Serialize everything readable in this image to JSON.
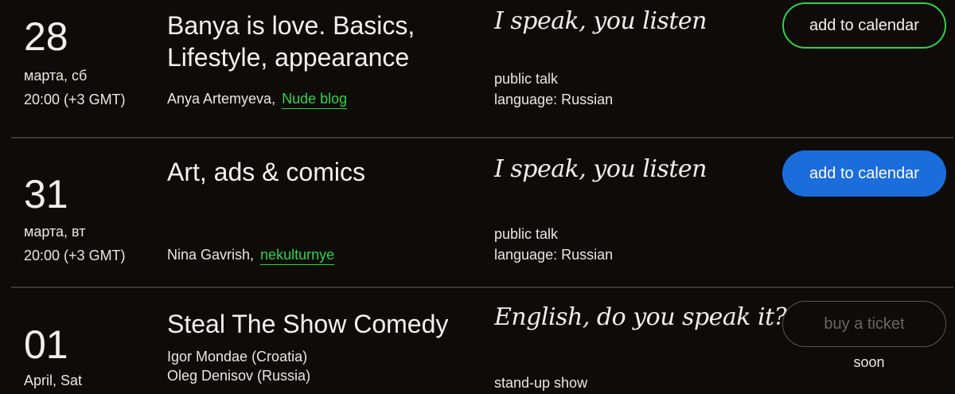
{
  "events": [
    {
      "day": "28",
      "weekday": "марта, сб",
      "time": "20:00 (+3 GMT)",
      "title": "Banya is love. Basics, Lifestyle, appearance",
      "speaker": "Anya Artemyeva,",
      "speaker_link": "Nude blog",
      "series": "I speak, you listen",
      "format": "public talk",
      "language": "language: Russian",
      "button": "add to calendar"
    },
    {
      "day": "31",
      "weekday": "марта, вт",
      "time": "20:00 (+3 GMT)",
      "title": "Art, ads & comics",
      "speaker": "Nina Gavrish,",
      "speaker_link": "nekulturnye",
      "series": "I speak, you listen",
      "format": "public talk",
      "language": "language: Russian",
      "button": "add to calendar"
    },
    {
      "day": "01",
      "weekday": "April, Sat",
      "title": "Steal The Show Comedy",
      "speakers": [
        "Igor Mondae (Croatia)",
        "Oleg Denisov (Russia)"
      ],
      "series": "English, do you speak it?",
      "format": "stand-up show",
      "button": "buy a ticket",
      "button_note": "soon"
    }
  ],
  "colors": {
    "background": "#0f0b09",
    "accent_green": "#2fd24a",
    "accent_blue": "#1a6ddb",
    "divider": "#3b3734"
  }
}
